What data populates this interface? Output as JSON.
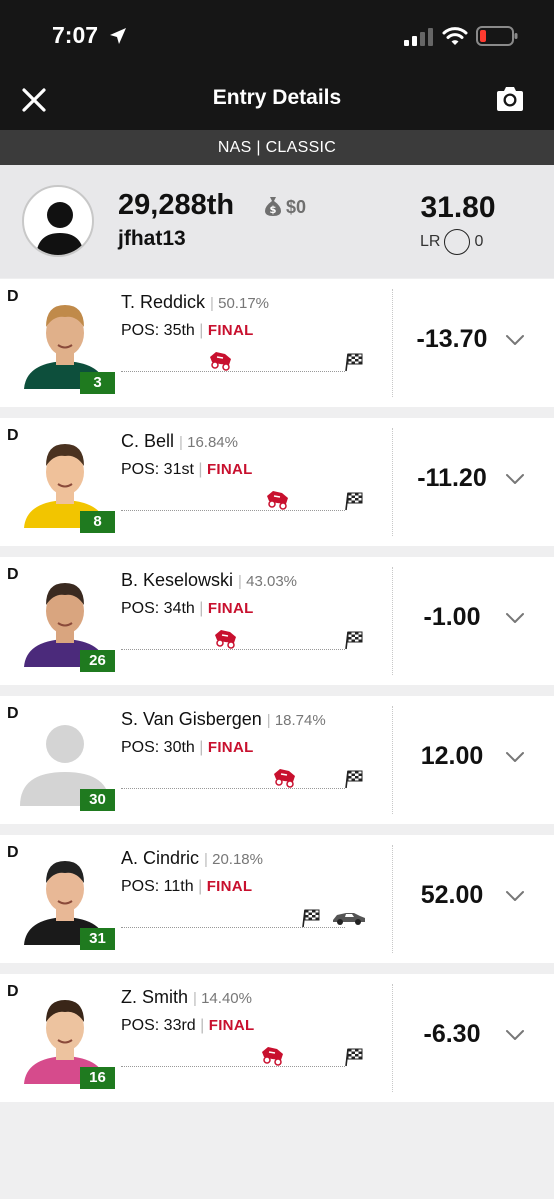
{
  "status_bar": {
    "time": "7:07"
  },
  "nav": {
    "title": "Entry Details"
  },
  "contest": {
    "label": "NAS | CLASSIC"
  },
  "summary": {
    "rank": "29,288th",
    "winnings": "$0",
    "username": "jfhat13",
    "total": "31.80",
    "lr_label": "LR",
    "lr_value": "0"
  },
  "colors": {
    "accent_red": "#c8102e",
    "badge_green": "#1f7a1f",
    "header_bg": "#161616"
  },
  "players": [
    {
      "pos_label": "D",
      "name": "T. Reddick",
      "pct": "50.17%",
      "pos_text": "POS: 35th",
      "status": "FINAL",
      "number": "3",
      "score": "-13.70",
      "icon": "wrecked-car-icon",
      "photo": "driver-photo"
    },
    {
      "pos_label": "D",
      "name": "C. Bell",
      "pct": "16.84%",
      "pos_text": "POS: 31st",
      "status": "FINAL",
      "number": "8",
      "score": "-11.20",
      "icon": "wrecked-car-icon",
      "photo": "driver-photo"
    },
    {
      "pos_label": "D",
      "name": "B. Keselowski",
      "pct": "43.03%",
      "pos_text": "POS: 34th",
      "status": "FINAL",
      "number": "26",
      "score": "-1.00",
      "icon": "wrecked-car-icon",
      "photo": "driver-photo"
    },
    {
      "pos_label": "D",
      "name": "S. Van Gisbergen",
      "pct": "18.74%",
      "pos_text": "POS: 30th",
      "status": "FINAL",
      "number": "30",
      "score": "12.00",
      "icon": "wrecked-car-icon",
      "photo": "placeholder-avatar"
    },
    {
      "pos_label": "D",
      "name": "A. Cindric",
      "pct": "20.18%",
      "pos_text": "POS: 11th",
      "status": "FINAL",
      "number": "31",
      "score": "52.00",
      "icon": "race-car-icon",
      "photo": "driver-photo"
    },
    {
      "pos_label": "D",
      "name": "Z. Smith",
      "pct": "14.40%",
      "pos_text": "POS: 33rd",
      "status": "FINAL",
      "number": "16",
      "score": "-6.30",
      "icon": "wrecked-car-icon",
      "photo": "driver-photo"
    }
  ]
}
